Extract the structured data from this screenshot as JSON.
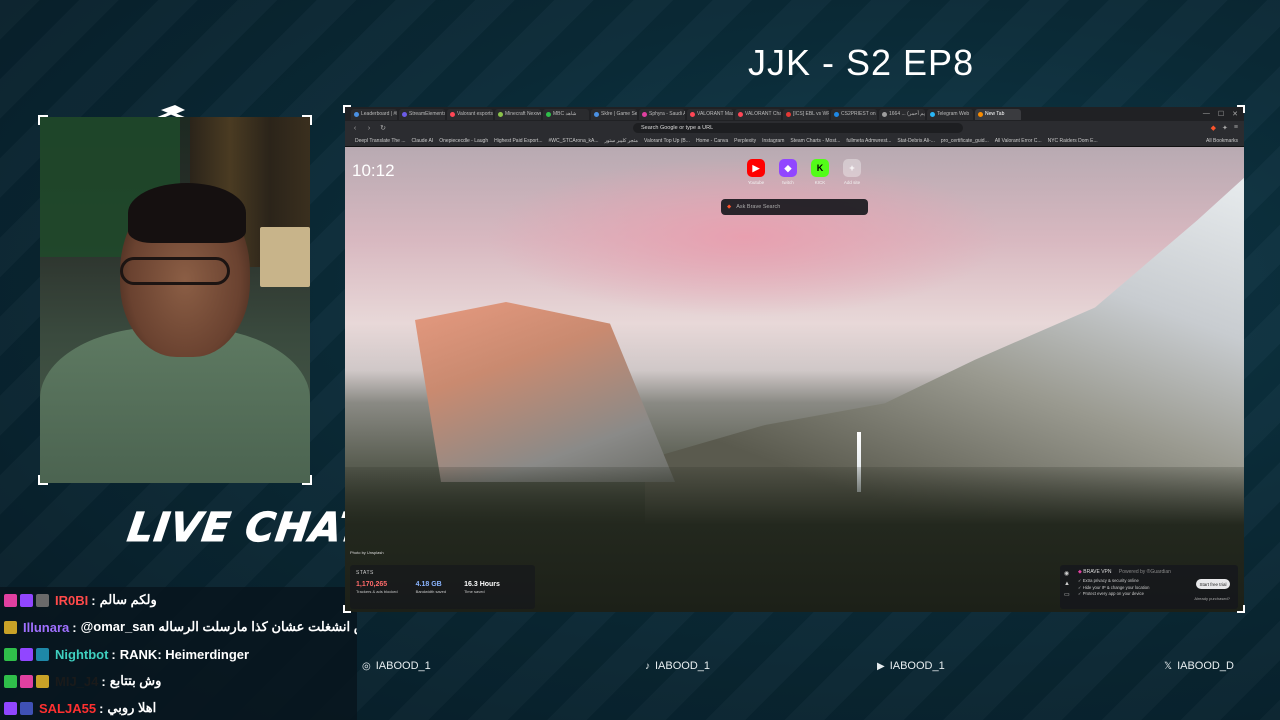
{
  "stream": {
    "title": "JJK - S2 EP8",
    "live_chat_label": "LIVE CHAT"
  },
  "chat": [
    {
      "badges": [
        "#e040a0",
        "#9146ff",
        "#6a6a6a"
      ],
      "name": "IR0BI",
      "name_color": "#ff4a4a",
      "separator": ":",
      "message": "ولكم سالم"
    },
    {
      "badges": [
        "#c9a227"
      ],
      "name": "Illunara",
      "name_color": "#a070ff",
      "separator": ":",
      "message": "@omar_san ت بس انشغلت عشان كذا مارسلت الرساله"
    },
    {
      "badges": [
        "#2fbf4a",
        "#9146ff",
        "#1e88a8"
      ],
      "name": "Nightbot",
      "name_color": "#3fd0c0",
      "separator": ":",
      "message": "RANK: Heimerdinger"
    },
    {
      "badges": [
        "#2fbf4a",
        "#e040a0",
        "#c9a227"
      ],
      "name": "MIJ_J4",
      "name_color": "#1a1a1a",
      "separator": ":",
      "message": "وش بتتابع"
    },
    {
      "badges": [
        "#9146ff",
        "#3f51b5"
      ],
      "name": "SALJA55",
      "name_color": "#ff3030",
      "separator": ":",
      "message": "اهلا روبي"
    }
  ],
  "browser": {
    "tabs": [
      {
        "label": "Leaderboard | #Blasts",
        "color": "#4a90e2"
      },
      {
        "label": "StreamElements | The",
        "color": "#6c5ce7"
      },
      {
        "label": "Valorant esports schedule",
        "color": "#ff4655"
      },
      {
        "label": "Minecraft Nexweekly",
        "color": "#8bc34a"
      },
      {
        "label": "MBC شاهد",
        "color": "#2fbf4a"
      },
      {
        "label": "Sklre | Game Servers",
        "color": "#4a90e2"
      },
      {
        "label": "Sphyra - Saudi Arabia",
        "color": "#e040a0"
      },
      {
        "label": "VALORANT Masters",
        "color": "#ff4655"
      },
      {
        "label": "VALORANT Challengers",
        "color": "#ff4655"
      },
      {
        "label": "[ICS] EBL vs WRC",
        "color": "#e53935"
      },
      {
        "label": "CS2PRIEST on Steam",
        "color": "#1e88e5"
      },
      {
        "label": "1664 ... (تقويم أحمر)",
        "color": "#9e9e9e"
      },
      {
        "label": "Telegram Web",
        "color": "#29b6f6"
      },
      {
        "label": "New Tab",
        "color": "#fb8c00",
        "active": true
      }
    ],
    "window_controls": [
      "—",
      "☐",
      "✕"
    ],
    "omnibox_placeholder": "Search Google or type a URL",
    "bookmarks": [
      "Deepl Translate The ...",
      "Claude AI",
      "Onepiececdle - Laugh",
      "Highest Paid Esport...",
      "#WC_STCArona_kA...",
      "متجر كليبر ستور",
      "Valorant Top Up (B...",
      "Home - Canva",
      "Perplexity",
      "Instagram",
      "Steam Charts - Most...",
      "fullmeta Admwrest...",
      "Stat-Debris Ali-...",
      "pro_certificate_guid...",
      "All Valorant Error C...",
      "NYC Raiders Dom E..."
    ],
    "all_bookmarks_label": "All Bookmarks"
  },
  "newtab": {
    "clock": "10:12",
    "shortcuts": [
      {
        "label": "Youtube",
        "glyph": "▶",
        "bg": "#ff0000",
        "fg": "#ffffff"
      },
      {
        "label": "twitch",
        "glyph": "◆",
        "bg": "#9146ff",
        "fg": "#ffffff"
      },
      {
        "label": "KICK",
        "glyph": "K",
        "bg": "#53fc18",
        "fg": "#000000"
      },
      {
        "label": "Add site",
        "glyph": "+",
        "bg": "rgba(255,255,255,0.35)",
        "fg": "#ffffff"
      }
    ],
    "search_placeholder": "Ask Brave Search",
    "photo_credit": "Photo by Unsplash",
    "stats": {
      "title": "STATS",
      "items": [
        {
          "value": "1,170,265",
          "label": "Trackers & ads blocked",
          "color": "#ff6a6a"
        },
        {
          "value": "4.18 GB",
          "label": "Bandwidth saved",
          "color": "#8ab4ff"
        },
        {
          "value": "16.3 Hours",
          "label": "Time saved",
          "color": "#ffffff"
        }
      ]
    },
    "vpn": {
      "title": "BRAVE VPN",
      "subtitle": "Powered by ®Guardian",
      "features": [
        "Extra privacy & security online",
        "Hide your IP & change your location",
        "Protect every app on your device"
      ],
      "button": "Start free trial",
      "link": "Already purchased?"
    }
  },
  "socials": [
    {
      "icon": "instagram-icon",
      "glyph": "◎",
      "handle": "IABOOD_1"
    },
    {
      "icon": "tiktok-icon",
      "glyph": "♪",
      "handle": "IABOOD_1"
    },
    {
      "icon": "youtube-icon",
      "glyph": "▶",
      "handle": "IABOOD_1"
    },
    {
      "icon": "x-icon",
      "glyph": "𝕏",
      "handle": "IABOOD_D"
    }
  ]
}
